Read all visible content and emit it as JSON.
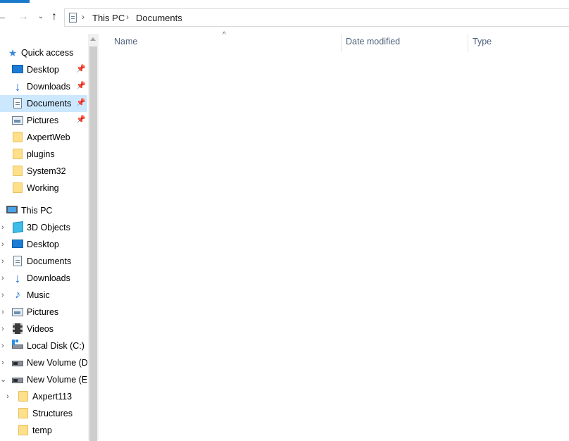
{
  "breadcrumb": [
    "This PC",
    "Documents"
  ],
  "columns": [
    "Name",
    "Date modified",
    "Type"
  ],
  "sidebar": {
    "quick_access": {
      "label": "Quick access",
      "items": [
        {
          "label": "Desktop",
          "pinned": true
        },
        {
          "label": "Downloads",
          "pinned": true
        },
        {
          "label": "Documents",
          "pinned": true,
          "selected": true
        },
        {
          "label": "Pictures",
          "pinned": true
        },
        {
          "label": "AxpertWeb"
        },
        {
          "label": "plugins"
        },
        {
          "label": "System32"
        },
        {
          "label": "Working"
        }
      ]
    },
    "this_pc": {
      "label": "This PC",
      "items": [
        {
          "label": "3D Objects"
        },
        {
          "label": "Desktop"
        },
        {
          "label": "Documents"
        },
        {
          "label": "Downloads"
        },
        {
          "label": "Music"
        },
        {
          "label": "Pictures"
        },
        {
          "label": "Videos"
        },
        {
          "label": "Local Disk (C:)"
        },
        {
          "label": "New Volume (D:"
        },
        {
          "label": "New Volume (E:)"
        }
      ]
    },
    "volume_e_children": [
      {
        "label": "Axpert113"
      },
      {
        "label": "Structures"
      },
      {
        "label": "temp"
      }
    ]
  },
  "icons": {
    "back": "arrow-left-icon",
    "forward": "arrow-right-icon",
    "recent": "chevron-down-icon",
    "up": "arrow-up-icon",
    "pin": "pin-icon",
    "sort": "sort-ascending-icon"
  },
  "colors": {
    "selection": "#cce8ff",
    "accent": "#1979ca",
    "header_text": "#4c607a"
  }
}
